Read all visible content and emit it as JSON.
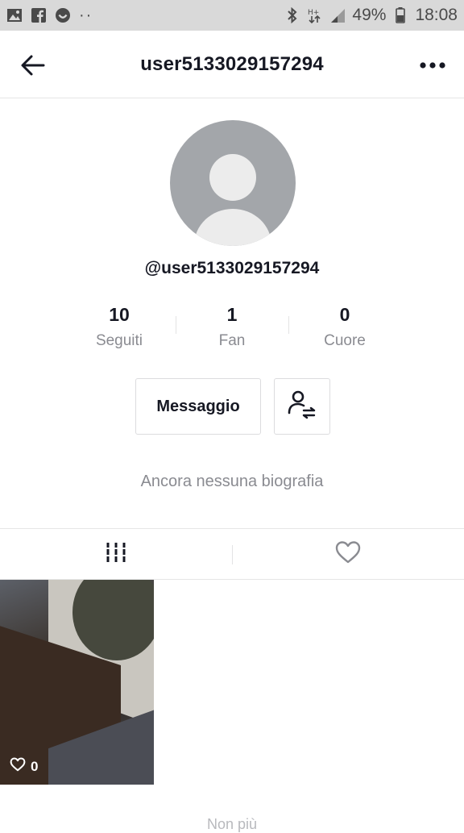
{
  "status_bar": {
    "battery": "49%",
    "time": "18:08",
    "icons": [
      "gallery-icon",
      "facebook-icon",
      "chat-icon",
      "more-notifications-icon",
      "bluetooth-icon",
      "data-icon",
      "signal-icon",
      "battery-icon"
    ]
  },
  "header": {
    "title": "user5133029157294",
    "back_icon": "arrow-left-icon",
    "more_icon": "more-horizontal-icon"
  },
  "profile": {
    "handle": "@user5133029157294",
    "bio": "Ancora nessuna biografia"
  },
  "stats": [
    {
      "value": "10",
      "label": "Seguiti"
    },
    {
      "value": "1",
      "label": "Fan"
    },
    {
      "value": "0",
      "label": "Cuore"
    }
  ],
  "actions": {
    "message_label": "Messaggio",
    "follow_icon": "user-switch-icon"
  },
  "tabs": [
    {
      "icon": "videos-grid-icon",
      "active": true
    },
    {
      "icon": "heart-outline-icon",
      "active": false
    }
  ],
  "videos": [
    {
      "likes": "0"
    }
  ],
  "footer": {
    "text": "Non più"
  }
}
